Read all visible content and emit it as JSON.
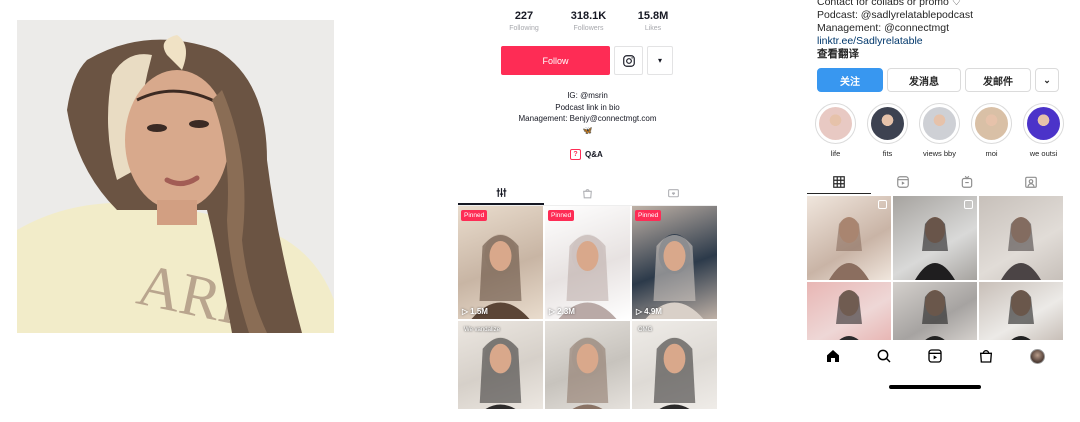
{
  "tiktok": {
    "stats": [
      {
        "value": "227",
        "label": "Following"
      },
      {
        "value": "318.1K",
        "label": "Followers"
      },
      {
        "value": "15.8M",
        "label": "Likes"
      }
    ],
    "follow_label": "Follow",
    "more_label": "▾",
    "bio": {
      "line1": "IG: @msrin",
      "line2": "Podcast link in bio",
      "line3": "Management: Benjy@connectmgt.com",
      "line4": "🦋"
    },
    "qa_label": "Q&A",
    "pinned_label": "Pinned",
    "videos": [
      {
        "pinned": true,
        "views": "1.5M",
        "palette": [
          "#c8b5a4",
          "#5b4536",
          "#e9dccd"
        ]
      },
      {
        "pinned": true,
        "views": "2.3M",
        "palette": [
          "#e7e2e1",
          "#b9a9a6",
          "#ffffff"
        ]
      },
      {
        "pinned": true,
        "views": "4.9M",
        "palette": [
          "#2c3a4a",
          "#d9d0c8",
          "#bfb1a6"
        ]
      },
      {
        "pinned": false,
        "views": "",
        "overlay": "We vandalize",
        "palette": [
          "#d6d0c9",
          "#2d2b2b",
          "#ece7e1"
        ]
      },
      {
        "pinned": false,
        "views": "",
        "palette": [
          "#c7c3bd",
          "#8a7365",
          "#e5e1dc"
        ]
      },
      {
        "pinned": false,
        "views": "",
        "overlay": "OMG",
        "palette": [
          "#dedad5",
          "#2b2a2a",
          "#efece8"
        ]
      }
    ]
  },
  "instagram": {
    "bio": {
      "line0": "Contact for collabs or promo ♡",
      "line1": "Podcast: @sadlyrelatablepodcast",
      "line2": "Management: @connectmgt",
      "line3": "linktr.ee/Sadlyrelatable",
      "line4": "查看翻译"
    },
    "buttons": {
      "follow": "关注",
      "message": "发消息",
      "email": "发邮件",
      "more": "⌄"
    },
    "highlights": [
      {
        "name": "life",
        "color": "#e8c9c3"
      },
      {
        "name": "fits",
        "color": "#3d4251"
      },
      {
        "name": "views bby",
        "color": "#ced0d5"
      },
      {
        "name": "moi",
        "color": "#d9c0a6"
      },
      {
        "name": "we outsi",
        "color": "#4b33c9"
      }
    ],
    "posts": [
      {
        "palette": [
          "#c9b4a6",
          "#8b6e5f",
          "#f0e6dd"
        ],
        "badge": true
      },
      {
        "palette": [
          "#d9d9d8",
          "#1f1e1f",
          "#a6a39f"
        ],
        "badge": true
      },
      {
        "palette": [
          "#e1dcd7",
          "#4b4445",
          "#c7c0ba"
        ],
        "badge": false
      },
      {
        "palette": [
          "#eed7d6",
          "#2b2a2c",
          "#e8b6b4"
        ],
        "badge": false
      },
      {
        "palette": [
          "#a6a3a1",
          "#222",
          "#d4d0cc"
        ],
        "badge": false
      },
      {
        "palette": [
          "#eceae7",
          "#222",
          "#c8bfb8"
        ],
        "badge": false
      }
    ],
    "nav": [
      "home-icon",
      "search-icon",
      "reels-icon",
      "shop-icon",
      "profile-icon"
    ]
  }
}
